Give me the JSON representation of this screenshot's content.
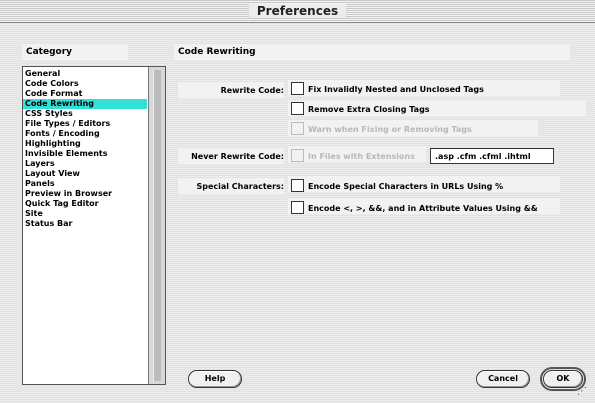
{
  "window": {
    "title": "Preferences"
  },
  "sidebar": {
    "header": "Category",
    "items": [
      {
        "label": "General"
      },
      {
        "label": "Code Colors"
      },
      {
        "label": "Code Format"
      },
      {
        "label": "Code Rewriting",
        "selected": true
      },
      {
        "label": "CSS Styles"
      },
      {
        "label": "File Types / Editors"
      },
      {
        "label": "Fonts / Encoding"
      },
      {
        "label": "Highlighting"
      },
      {
        "label": "Invisible Elements"
      },
      {
        "label": "Layers"
      },
      {
        "label": "Layout View"
      },
      {
        "label": "Panels"
      },
      {
        "label": "Preview in Browser"
      },
      {
        "label": "Quick Tag Editor"
      },
      {
        "label": "Site"
      },
      {
        "label": "Status Bar"
      }
    ]
  },
  "panel": {
    "header": "Code Rewriting",
    "rewrite_code": {
      "label": "Rewrite Code:",
      "options": [
        {
          "label": "Fix Invalidly Nested and Unclosed Tags",
          "checked": false,
          "enabled": true
        },
        {
          "label": "Remove Extra Closing Tags",
          "checked": false,
          "enabled": true
        },
        {
          "label": "Warn when Fixing or Removing Tags",
          "checked": false,
          "enabled": false
        }
      ]
    },
    "never_rewrite": {
      "label": "Never Rewrite Code:",
      "option": {
        "label": "In Files with Extensions",
        "checked": false,
        "enabled": false
      },
      "extensions_value": ".asp .cfm .cfml .ihtml"
    },
    "special_chars": {
      "label": "Special Characters:",
      "options": [
        {
          "label": "Encode Special Characters in URLs Using %",
          "checked": false
        },
        {
          "label": "Encode <, >, &&, and  in Attribute Values Using &&",
          "checked": false
        }
      ]
    }
  },
  "buttons": {
    "help": "Help",
    "cancel": "Cancel",
    "ok": "OK"
  },
  "colors": {
    "selection": "#33e0d8"
  }
}
